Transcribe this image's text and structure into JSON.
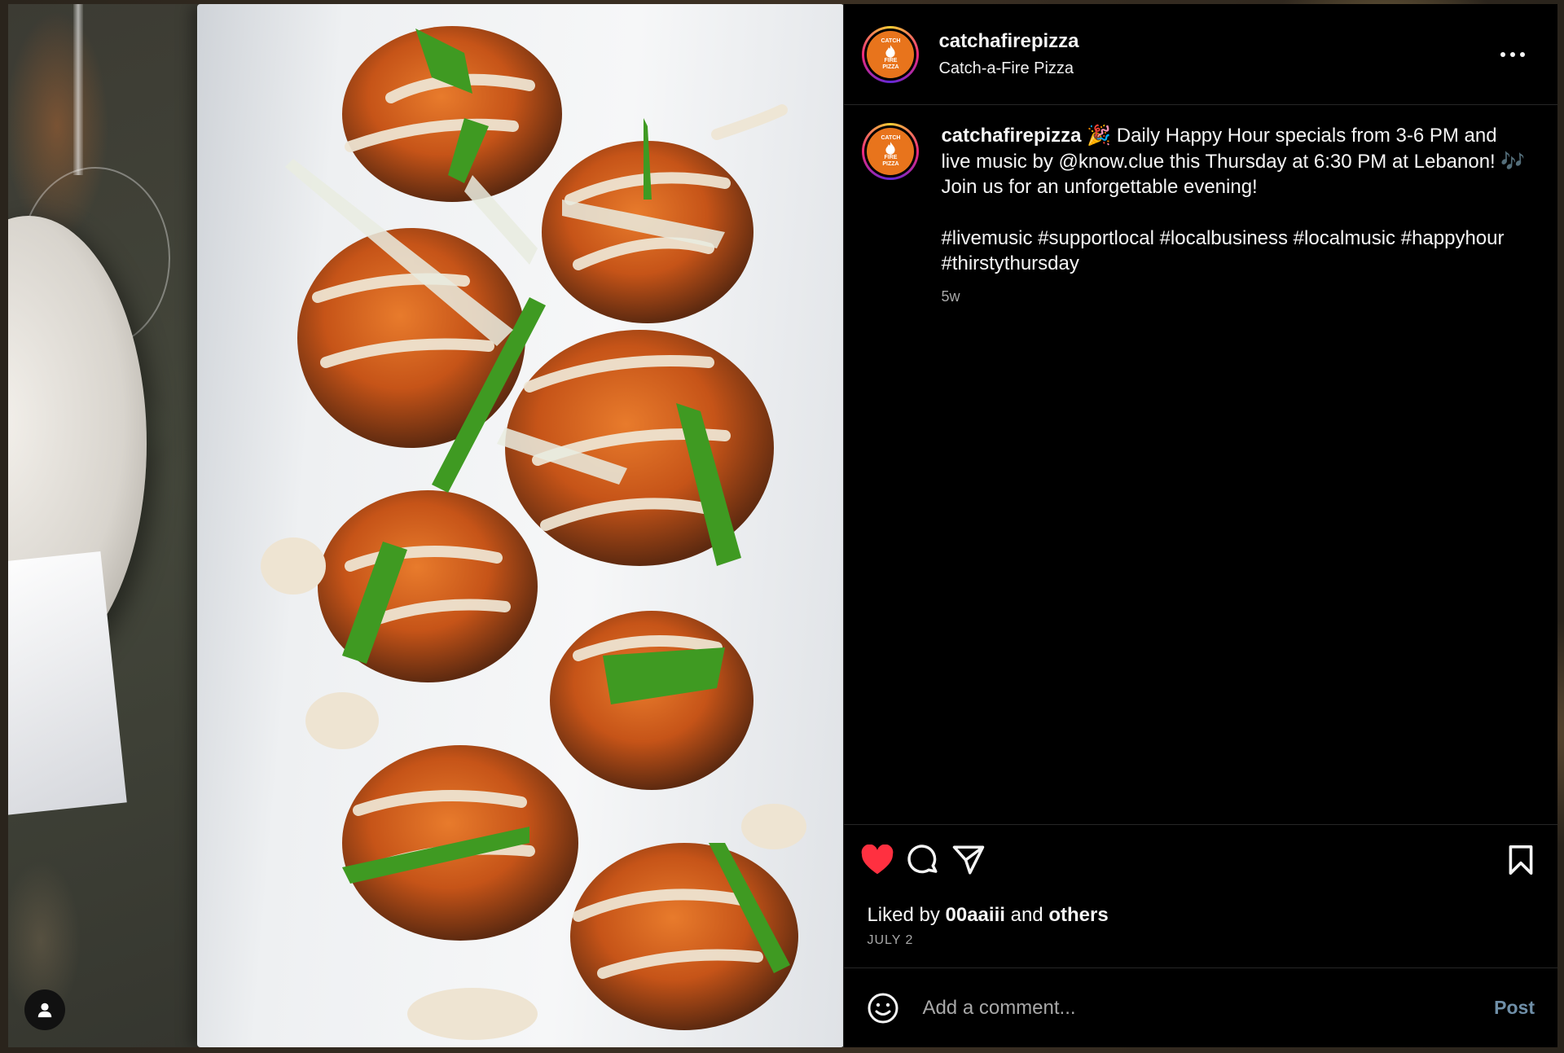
{
  "post": {
    "username": "catchafirepizza",
    "fullname": "Catch-a-Fire Pizza",
    "avatar_text": [
      "CATCH",
      "FIRE",
      "PIZZA"
    ],
    "caption": {
      "username": "catchafirepizza",
      "text": " 🎉 Daily Happy Hour specials from 3-6 PM and live music by @know.clue this Thursday at 6:30 PM at Lebanon! 🎶 Join us for an unforgettable evening!",
      "hashtags": "#livemusic #supportlocal #localbusiness #localmusic #happyhour #thirstythursday"
    },
    "time_ago": "5w",
    "likes": {
      "prefix": "Liked by ",
      "user": "00aaiii",
      "middle": " and ",
      "others": "others"
    },
    "date": "JULY 2"
  },
  "comment": {
    "placeholder": "Add a comment...",
    "post_label": "Post"
  },
  "icons": {
    "like": "heart-icon",
    "comment": "comment-icon",
    "share": "share-icon",
    "save": "bookmark-icon",
    "emoji": "emoji-icon",
    "more": "more-icon",
    "user_tag": "user-tag-icon"
  },
  "colors": {
    "liked_heart": "#ff3040",
    "avatar_bg": "#e8741c",
    "post_button": "#6f8fa8",
    "secondary_text": "#a8a8a8"
  }
}
